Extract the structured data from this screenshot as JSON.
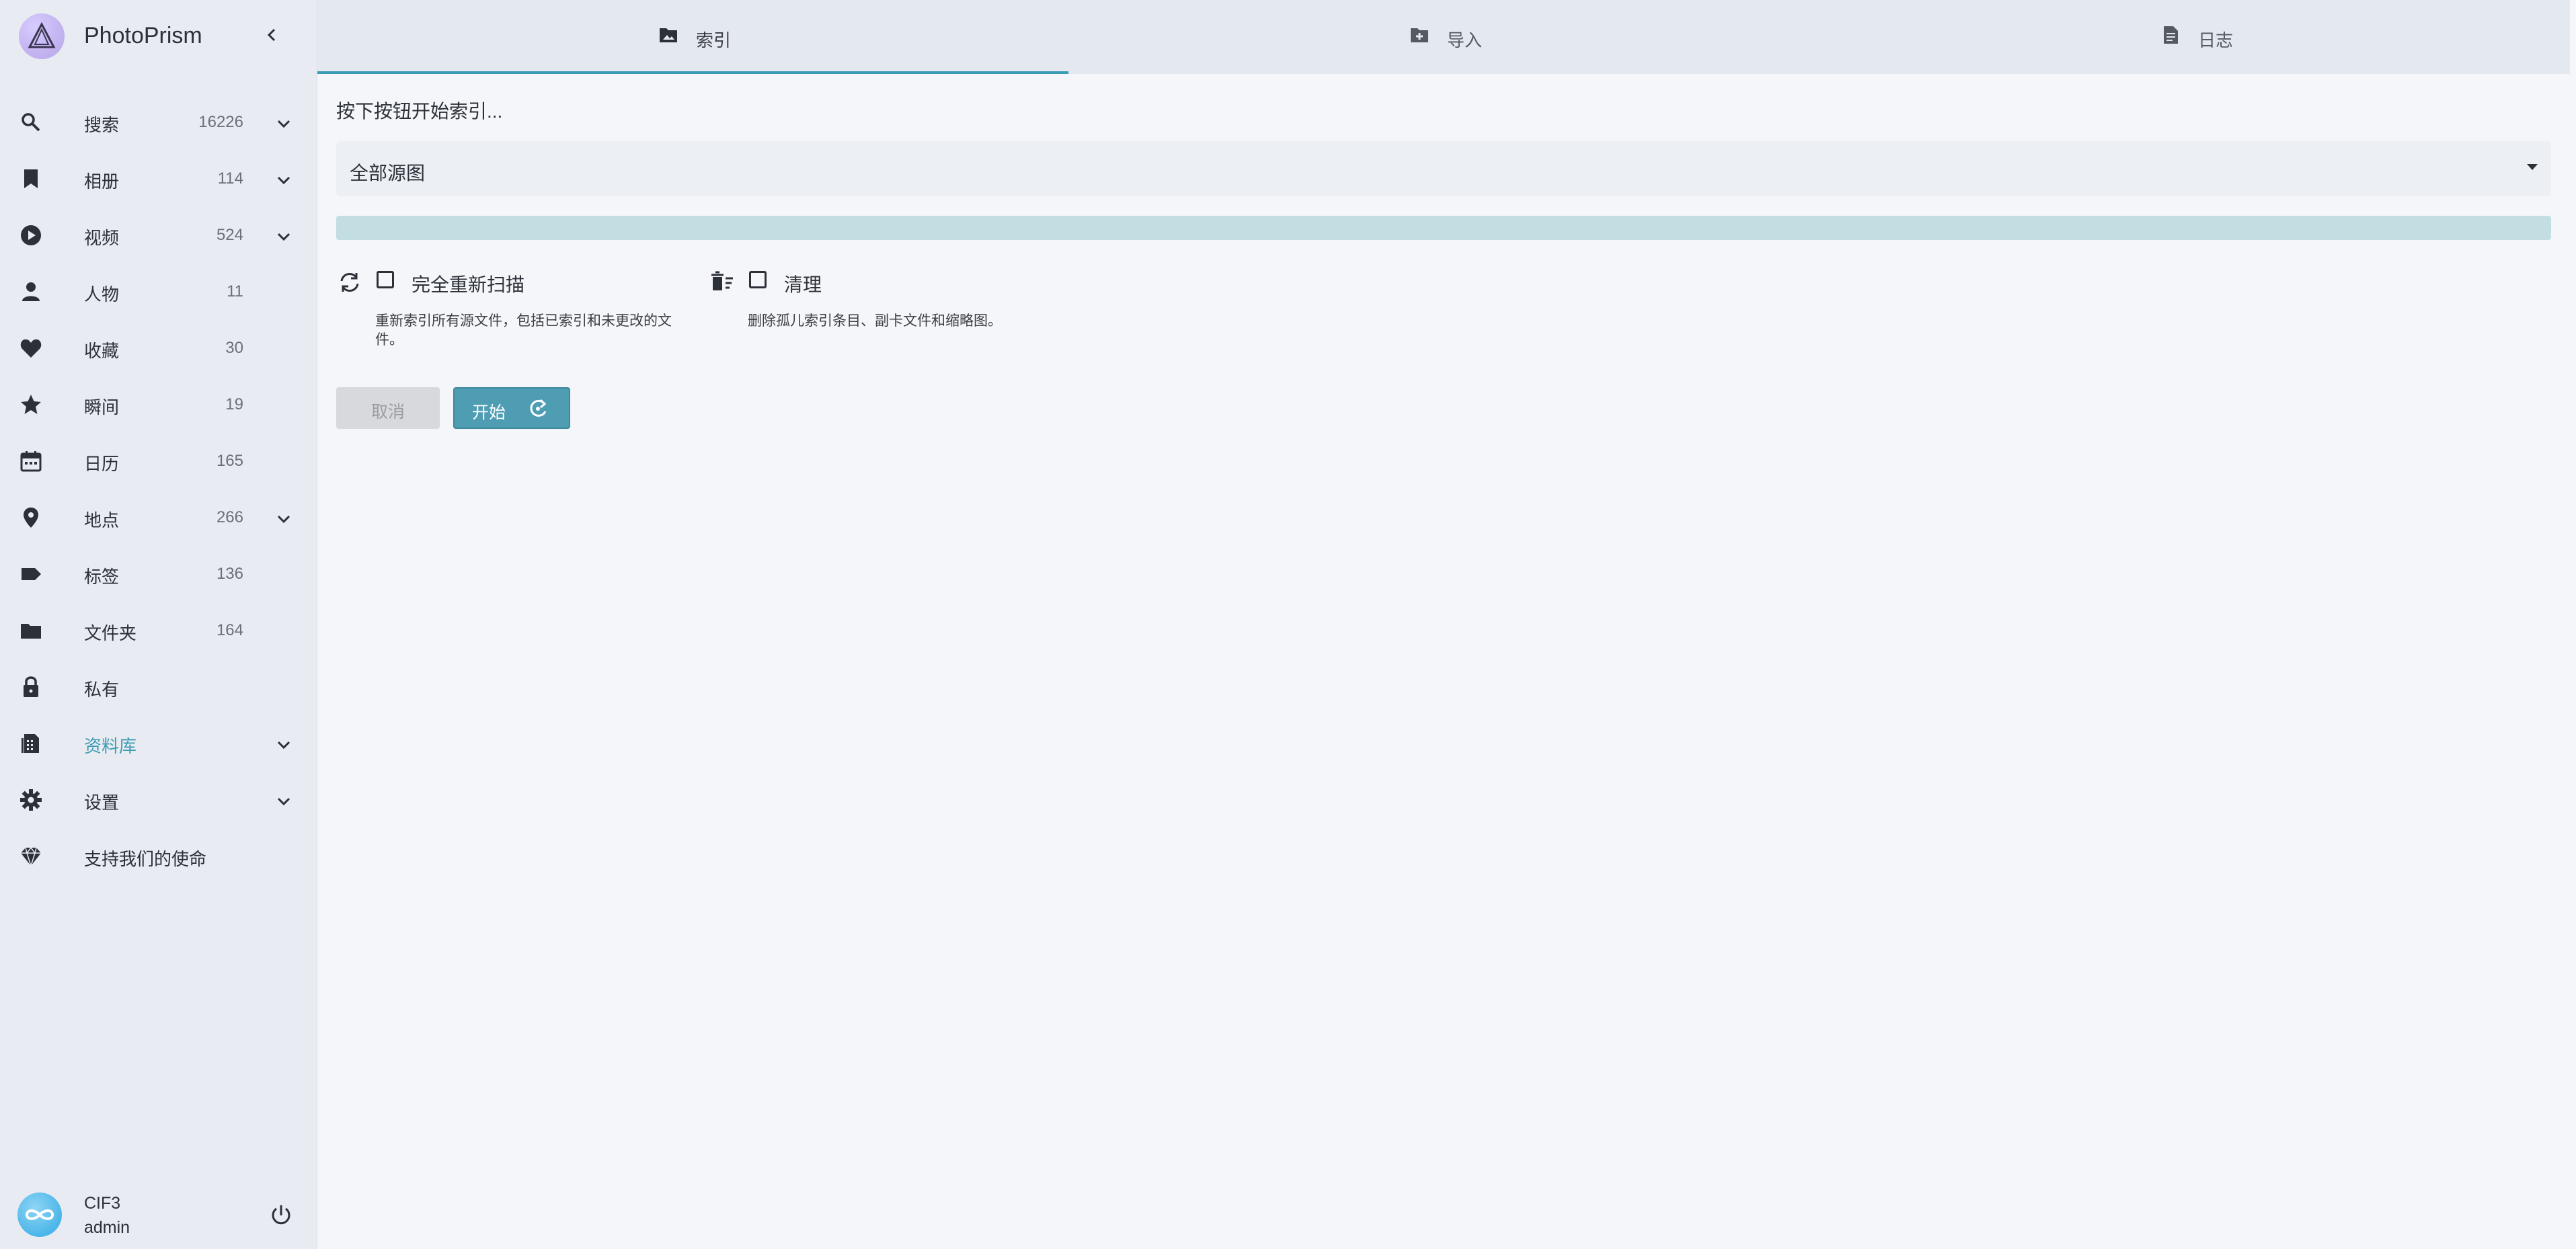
{
  "brand": {
    "name": "PhotoPrism"
  },
  "sidebar": {
    "items": [
      {
        "label": "搜索",
        "count": "16226",
        "expandable": true,
        "icon": "search-icon"
      },
      {
        "label": "相册",
        "count": "114",
        "expandable": true,
        "icon": "bookmark-icon"
      },
      {
        "label": "视频",
        "count": "524",
        "expandable": true,
        "icon": "play-circle-icon"
      },
      {
        "label": "人物",
        "count": "11",
        "expandable": false,
        "icon": "person-icon"
      },
      {
        "label": "收藏",
        "count": "30",
        "expandable": false,
        "icon": "heart-icon"
      },
      {
        "label": "瞬间",
        "count": "19",
        "expandable": false,
        "icon": "star-icon"
      },
      {
        "label": "日历",
        "count": "165",
        "expandable": false,
        "icon": "calendar-icon"
      },
      {
        "label": "地点",
        "count": "266",
        "expandable": true,
        "icon": "location-pin-icon"
      },
      {
        "label": "标签",
        "count": "136",
        "expandable": false,
        "icon": "label-tag-icon"
      },
      {
        "label": "文件夹",
        "count": "164",
        "expandable": false,
        "icon": "folder-icon"
      },
      {
        "label": "私有",
        "count": "",
        "expandable": false,
        "icon": "lock-icon"
      },
      {
        "label": "资料库",
        "count": "",
        "expandable": true,
        "icon": "library-icon",
        "active": true
      },
      {
        "label": "设置",
        "count": "",
        "expandable": true,
        "icon": "gear-icon"
      },
      {
        "label": "支持我们的使命",
        "count": "",
        "expandable": false,
        "icon": "diamond-icon"
      }
    ],
    "user": {
      "name": "CIF3",
      "role": "admin"
    }
  },
  "tabs": [
    {
      "label": "索引",
      "icon": "folder-image-icon",
      "active": true
    },
    {
      "label": "导入",
      "icon": "folder-plus-icon",
      "active": false
    },
    {
      "label": "日志",
      "icon": "log-file-icon",
      "active": false
    }
  ],
  "main": {
    "hint": "按下按钮开始索引...",
    "select_value": "全部源图",
    "progress": 0,
    "options": [
      {
        "label": "完全重新扫描",
        "description": "重新索引所有源文件，包括已索引和未更改的文件。",
        "checked": false
      },
      {
        "label": "清理",
        "description": "删除孤儿索引条目、副卡文件和缩略图。",
        "checked": false
      }
    ],
    "cancel_label": "取消",
    "start_label": "开始"
  },
  "colors": {
    "accent": "#3b9cb5",
    "sidebar_bg": "#e8ebf1",
    "page_bg": "#f4f6f9"
  }
}
